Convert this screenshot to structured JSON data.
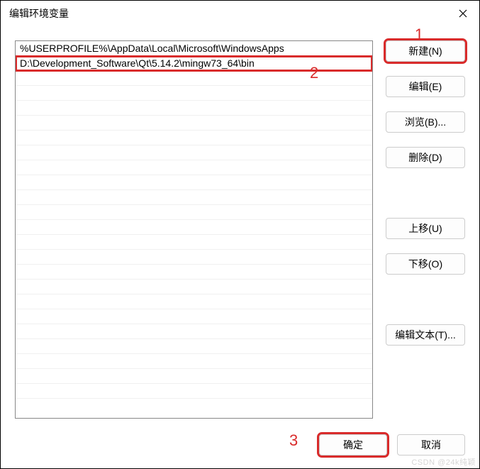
{
  "window": {
    "title": "编辑环境变量"
  },
  "list": {
    "items": [
      "%USERPROFILE%\\AppData\\Local\\Microsoft\\WindowsApps",
      "D:\\Development_Software\\Qt\\5.14.2\\mingw73_64\\bin"
    ]
  },
  "buttons": {
    "new": "新建(N)",
    "edit": "编辑(E)",
    "browse": "浏览(B)...",
    "delete": "删除(D)",
    "moveup": "上移(U)",
    "movedown": "下移(O)",
    "edittext": "编辑文本(T)...",
    "ok": "确定",
    "cancel": "取消"
  },
  "annotations": {
    "a1": "1",
    "a2": "2",
    "a3": "3"
  },
  "watermark": "CSDN @24k纯颖"
}
